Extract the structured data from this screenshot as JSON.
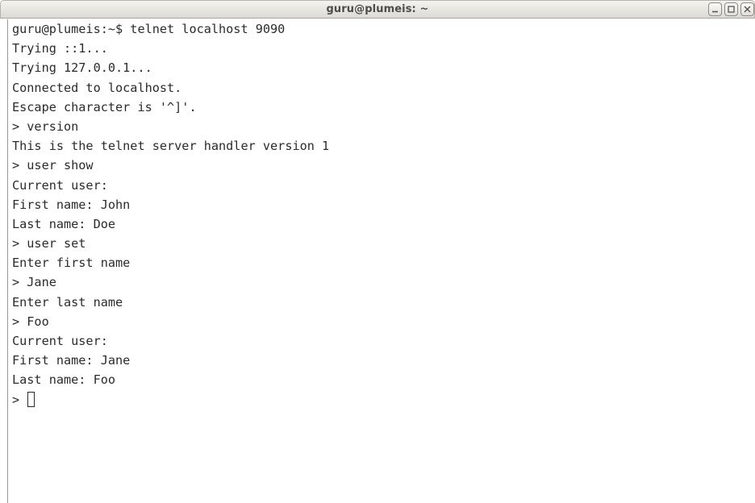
{
  "window": {
    "title": "guru@plumeis: ~"
  },
  "controls": {
    "minimize_icon": "minimize-icon",
    "maximize_icon": "maximize-icon",
    "close_icon": "close-icon"
  },
  "terminal": {
    "lines": [
      "guru@plumeis:~$ telnet localhost 9090",
      "Trying ::1...",
      "Trying 127.0.0.1...",
      "Connected to localhost.",
      "Escape character is '^]'.",
      "> version",
      "This is the telnet server handler version 1",
      "> user show",
      "Current user:",
      "First name: John",
      "Last name: Doe",
      "> user set",
      "Enter first name",
      "> Jane",
      "Enter last name",
      "> Foo",
      "Current user:",
      "First name: Jane",
      "Last name: Foo"
    ],
    "prompt": "> "
  }
}
